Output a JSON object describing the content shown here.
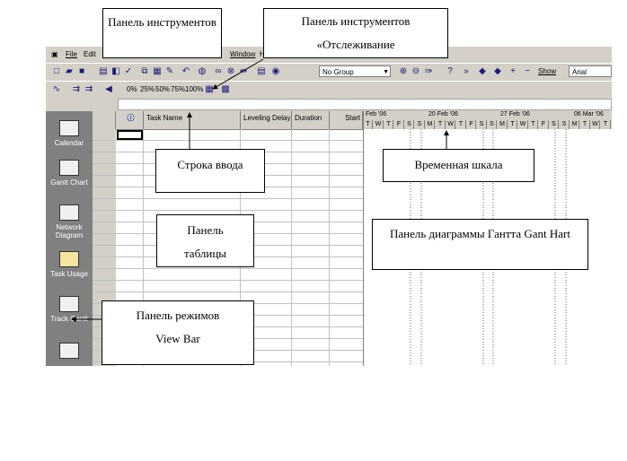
{
  "menu": {
    "items": [
      "File",
      "Edit",
      "Window",
      "H"
    ]
  },
  "toolbar": {
    "group_combo": "No Group",
    "show_label": "Show",
    "font_combo": "Arial",
    "percent_labels": [
      "0%",
      "25%",
      "50%",
      "75%",
      "100%"
    ]
  },
  "view_bar": {
    "items": [
      {
        "label": "Calendar",
        "icon": "calendar-icon"
      },
      {
        "label": "Gantt Chart",
        "icon": "gantt-chart-icon"
      },
      {
        "label": "Network Diagram",
        "icon": "network-diagram-icon"
      },
      {
        "label": "Task Usage",
        "icon": "task-usage-icon"
      },
      {
        "label": "Track Gantt",
        "icon": "tracking-gantt-icon"
      },
      {
        "label": "",
        "icon": "resource-graph-icon"
      }
    ]
  },
  "table": {
    "columns": [
      "",
      "Task Name",
      "Leveling Delay",
      "Duration",
      "Start"
    ],
    "info_icon": "info-icon"
  },
  "timescale": {
    "weeks": [
      "Feb '06",
      "20 Feb '06",
      "27 Feb '06",
      "06 Mar '06"
    ],
    "days": [
      "T",
      "W",
      "T",
      "F",
      "S",
      "S",
      "M",
      "T",
      "W",
      "T",
      "F",
      "S",
      "S",
      "M",
      "T",
      "W",
      "T",
      "F",
      "S",
      "S",
      "M",
      "T",
      "W",
      "T"
    ]
  },
  "callouts": {
    "toolbar_panel": "Панель инструментов",
    "tracking_toolbar": "Панель инструментов «Отслеживание",
    "entry_bar": "Строка ввода",
    "timescale": "Временная шкала",
    "table_panel": "Панель таблицы",
    "gantt_panel": "Панель диаграммы Гантта Gant Hart",
    "view_bar": "Панель режимов View Bar"
  }
}
